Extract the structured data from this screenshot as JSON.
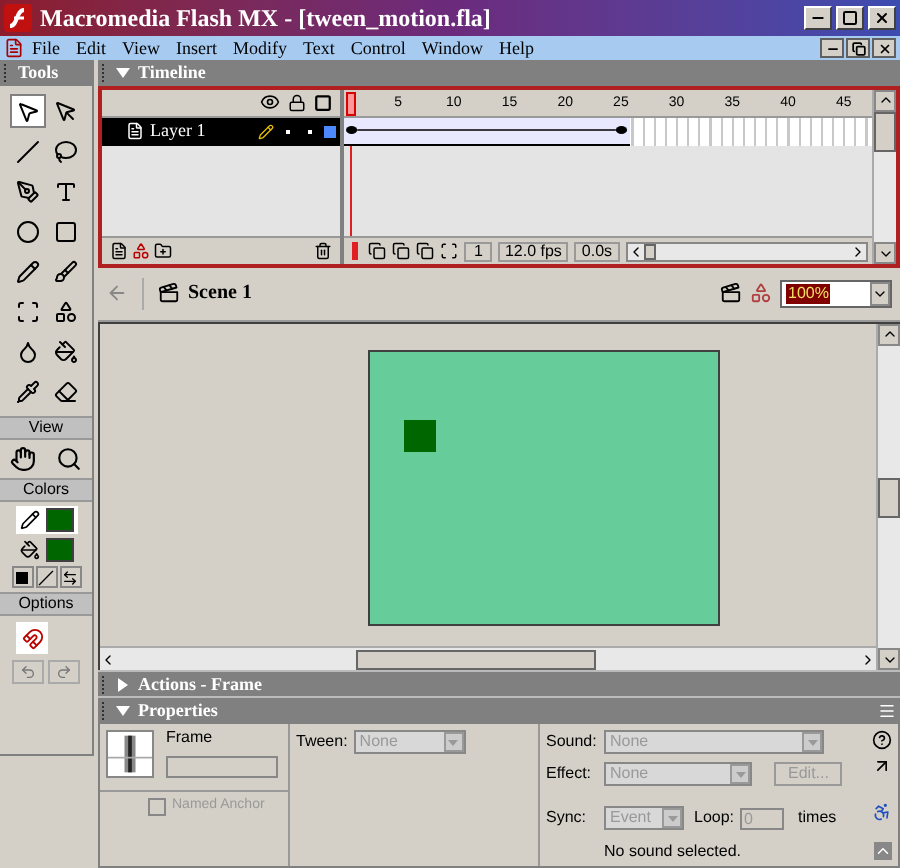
{
  "window": {
    "title": "Macromedia Flash MX - [tween_motion.fla]"
  },
  "menu": [
    "File",
    "Edit",
    "View",
    "Insert",
    "Modify",
    "Text",
    "Control",
    "Window",
    "Help"
  ],
  "tools": {
    "title": "Tools",
    "view_label": "View",
    "colors_label": "Colors",
    "options_label": "Options"
  },
  "timeline": {
    "title": "Timeline",
    "frame_numbers": [
      "5",
      "10",
      "15",
      "20",
      "25",
      "30",
      "35",
      "40",
      "45"
    ],
    "layers": [
      {
        "name": "Layer 1",
        "selected": true,
        "tween": {
          "level": 0.54
        }
      }
    ],
    "current_frame": "1",
    "fps": "12.0 fps",
    "time": "0.0s"
  },
  "scene": {
    "name": "Scene 1",
    "zoom": "100%"
  },
  "panels": [
    {
      "title": "Actions - Frame",
      "expanded": false
    },
    {
      "title": "Properties",
      "expanded": true
    }
  ],
  "properties": {
    "frame_label": "Frame",
    "tween_label": "Tween:",
    "tween_value": "None",
    "sound_label": "Sound:",
    "sound_value": "None",
    "effect_label": "Effect:",
    "effect_value": "None",
    "edit_button": "Edit...",
    "named_anchor": {
      "label": "Named Anchor",
      "checked": false
    },
    "sync_label": "Sync:",
    "sync_value": "Event",
    "loop_label": "Loop:",
    "loop_value": "0",
    "times_label": "times",
    "status": "No sound selected."
  }
}
